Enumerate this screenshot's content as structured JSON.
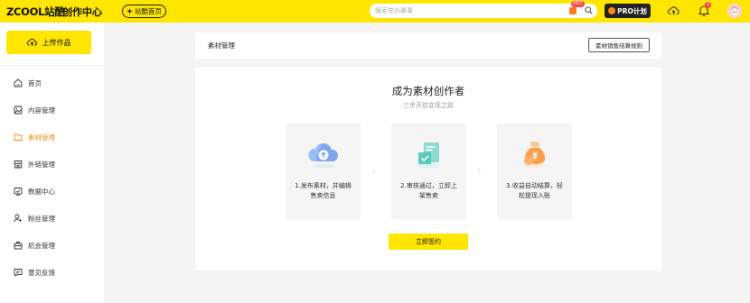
{
  "header": {
    "logo": "ZCOOL站酷",
    "logo_sub": "创作中心",
    "home_button": "站酷首页",
    "search_placeholder": "搜索举办赛事",
    "hot_badge": "HOT",
    "pro_button": "PRO计划",
    "notification_count": "1",
    "accent_color": "#ffe600"
  },
  "sidebar": {
    "upload_button": "上传作品",
    "items": [
      {
        "label": "首页",
        "icon": "home-icon",
        "active": false
      },
      {
        "label": "内容管理",
        "icon": "image-icon",
        "active": false
      },
      {
        "label": "素材管理",
        "icon": "folder-icon",
        "active": true
      },
      {
        "label": "外链管理",
        "icon": "store-icon",
        "active": false
      },
      {
        "label": "数据中心",
        "icon": "chart-icon",
        "active": false
      },
      {
        "label": "粉丝管理",
        "icon": "user-plus-icon",
        "active": false
      },
      {
        "label": "机会管理",
        "icon": "briefcase-icon",
        "active": false
      },
      {
        "label": "意见反馈",
        "icon": "message-icon",
        "active": false
      }
    ],
    "active_color": "#f28d16"
  },
  "main": {
    "section_title": "素材管理",
    "rules_button": "素材销售结算规则",
    "hero_title": "成为素材创作者",
    "hero_subtitle": "三步开启变现之路",
    "steps": [
      {
        "text": "1.发布素材，并编辑售卖信息",
        "icon": "cloud-upload-icon"
      },
      {
        "text": "2.审核通过，立即上架售卖",
        "icon": "approve-doc-icon"
      },
      {
        "text": "3.收益自动结算，轻松提现入账",
        "icon": "money-bag-icon"
      }
    ],
    "sign_button": "立即签约"
  }
}
